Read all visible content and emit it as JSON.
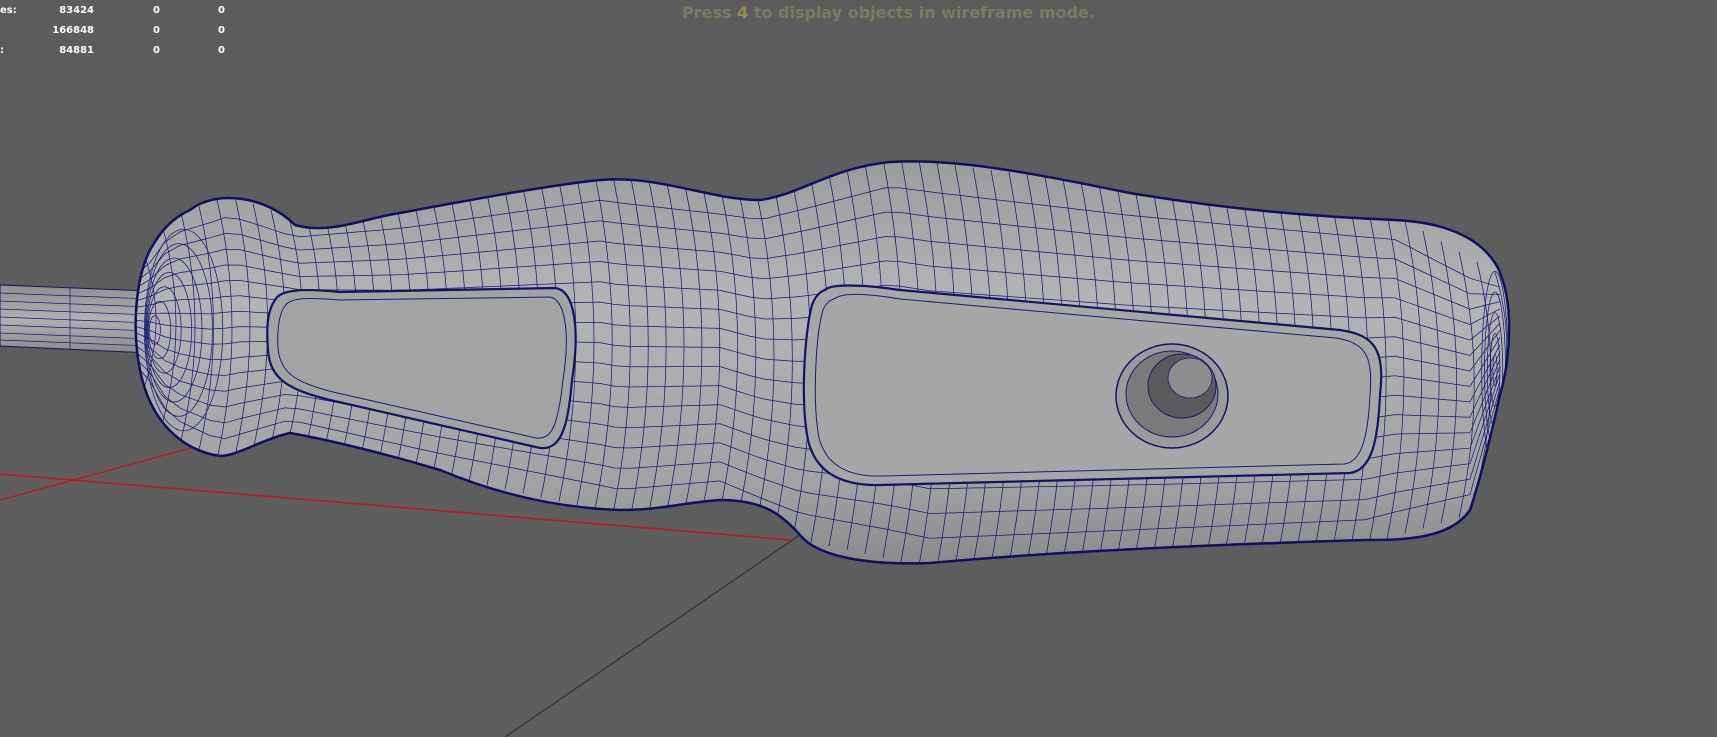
{
  "hud": {
    "rows": [
      {
        "label": "es:",
        "v1": "83424",
        "v2": "0",
        "v3": "0"
      },
      {
        "label": "",
        "v1": "166848",
        "v2": "0",
        "v3": "0"
      },
      {
        "label": ":",
        "v1": "84881",
        "v2": "0",
        "v3": "0"
      }
    ]
  },
  "hint": {
    "prefix": "Press ",
    "key": "4",
    "suffix": " to display objects in wireframe mode."
  },
  "colors": {
    "viewport_bg": "#5d5d5d",
    "mesh_fill": "#a9a9a9",
    "wire": "#1a1a72",
    "grid_x_axis": "#c8101e",
    "grid_z_axis": "#2a2a2a"
  },
  "viewport": {
    "object": "screwdriver-handle",
    "display_mode": "smooth-shaded-with-wireframe"
  }
}
